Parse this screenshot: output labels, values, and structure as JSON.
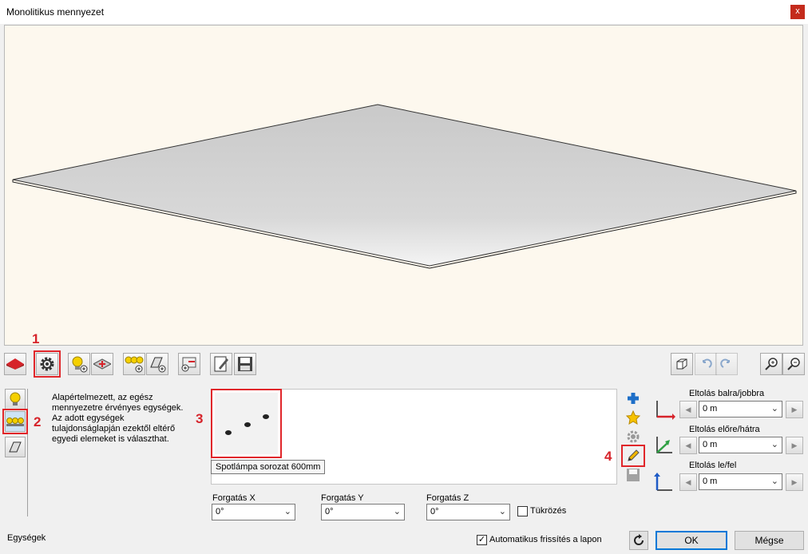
{
  "window": {
    "title": "Monolitikus mennyezet",
    "close_label": "x"
  },
  "annotations": [
    "1",
    "2",
    "3",
    "4"
  ],
  "description": "Alapértelmezett, az egész mennyezetre érvényes egységek. Az adott egységek tulajdonságlapján ezektől eltérő egyedi elemeket is választhat.",
  "gallery": {
    "selected_item_tooltip": "Spotlámpa sorozat 600mm"
  },
  "rotation": {
    "x_label": "Forgatás X",
    "x_value": "0°",
    "y_label": "Forgatás Y",
    "y_value": "0°",
    "z_label": "Forgatás Z",
    "z_value": "0°",
    "mirror_label": "Tükrözés",
    "mirror_checked": false
  },
  "offsets": {
    "left_right_label": "Eltolás balra/jobbra",
    "left_right_value": "0 m",
    "front_back_label": "Eltolás előre/hátra",
    "front_back_value": "0 m",
    "up_down_label": "Eltolás le/fel",
    "up_down_value": "0 m"
  },
  "footer": {
    "status_label": "Egységek",
    "auto_refresh_label": "Automatikus frissítés a lapon",
    "auto_refresh_checked": true,
    "ok_label": "OK",
    "cancel_label": "Mégse"
  },
  "colors": {
    "highlight": "#e0262a",
    "viewport_bg": "#fdf8ee",
    "primary_border": "#0078d7"
  }
}
